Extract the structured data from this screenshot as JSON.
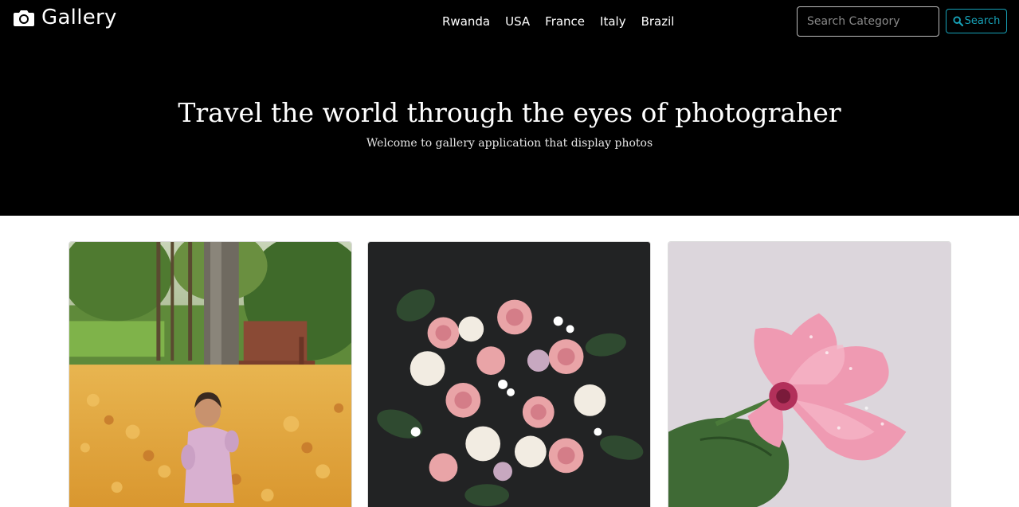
{
  "navbar": {
    "brand": {
      "label": "Gallery",
      "icon": "camera-icon"
    },
    "links": [
      {
        "label": "Rwanda"
      },
      {
        "label": "USA"
      },
      {
        "label": "France"
      },
      {
        "label": "Italy"
      },
      {
        "label": "Brazil"
      }
    ],
    "search": {
      "placeholder": "Search Category",
      "value": "",
      "button_label": "Search",
      "button_icon": "search-icon",
      "accent": "#17a2b8"
    }
  },
  "hero": {
    "title": "Travel the world through the eyes of photograher",
    "subtitle": "Welcome to gallery application that display photos",
    "background": "#000000"
  },
  "gallery": {
    "photos": [
      {
        "subject": "toddler sitting in autumn leaves by a park bench"
      },
      {
        "subject": "bouquet of pink and white roses on dark background"
      },
      {
        "subject": "pink flower with water droplets on light background"
      }
    ]
  }
}
